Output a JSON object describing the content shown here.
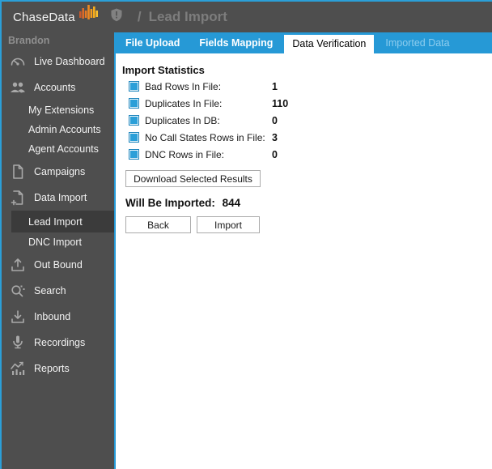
{
  "header": {
    "logo_text": "ChaseData",
    "breadcrumb_prefix": "/",
    "title": "Lead Import"
  },
  "sidebar": {
    "user": "Brandon",
    "items": [
      {
        "label": "Live Dashboard",
        "icon": "gauge-icon",
        "sub": false,
        "selected": false
      },
      {
        "label": "Accounts",
        "icon": "people-icon",
        "sub": false,
        "selected": false
      },
      {
        "label": "My Extensions",
        "icon": "",
        "sub": true,
        "selected": false
      },
      {
        "label": "Admin Accounts",
        "icon": "",
        "sub": true,
        "selected": false
      },
      {
        "label": "Agent Accounts",
        "icon": "",
        "sub": true,
        "selected": false
      },
      {
        "label": "Campaigns",
        "icon": "document-icon",
        "sub": false,
        "selected": false
      },
      {
        "label": "Data Import",
        "icon": "document-plus-icon",
        "sub": false,
        "selected": false
      },
      {
        "label": "Lead Import",
        "icon": "",
        "sub": true,
        "selected": true
      },
      {
        "label": "DNC Import",
        "icon": "",
        "sub": true,
        "selected": false
      },
      {
        "label": "Out Bound",
        "icon": "upload-icon",
        "sub": false,
        "selected": false
      },
      {
        "label": "Search",
        "icon": "search-icon",
        "sub": false,
        "selected": false
      },
      {
        "label": "Inbound",
        "icon": "download-icon",
        "sub": false,
        "selected": false
      },
      {
        "label": "Recordings",
        "icon": "microphone-icon",
        "sub": false,
        "selected": false
      },
      {
        "label": "Reports",
        "icon": "chart-icon",
        "sub": false,
        "selected": false
      }
    ]
  },
  "tabs": [
    {
      "label": "File Upload",
      "state": "normal"
    },
    {
      "label": "Fields Mapping",
      "state": "normal"
    },
    {
      "label": "Data Verification",
      "state": "active"
    },
    {
      "label": "Imported Data",
      "state": "disabled"
    }
  ],
  "content": {
    "section_title": "Import Statistics",
    "stats": [
      {
        "label": "Bad Rows In File:",
        "value": "1",
        "checked": true
      },
      {
        "label": "Duplicates In File:",
        "value": "110",
        "checked": true
      },
      {
        "label": "Duplicates In DB:",
        "value": "0",
        "checked": true
      },
      {
        "label": "No Call States Rows in File:",
        "value": "3",
        "checked": true
      },
      {
        "label": "DNC Rows in File:",
        "value": "0",
        "checked": true
      }
    ],
    "download_button": "Download Selected Results",
    "will_be_imported_label": "Will Be Imported:",
    "will_be_imported_value": "844",
    "back_button": "Back",
    "import_button": "Import"
  },
  "colors": {
    "accent_blue": "#2699D6",
    "window_border_blue": "#2B9FD8",
    "sidebar_gray": "#4E4E4E",
    "selected_item_gray": "#3B3B3B",
    "disabled_tab_text": "#8ECDEE",
    "checkbox_blue": "#2B9FD8",
    "logo_orange": "#F08A21"
  }
}
